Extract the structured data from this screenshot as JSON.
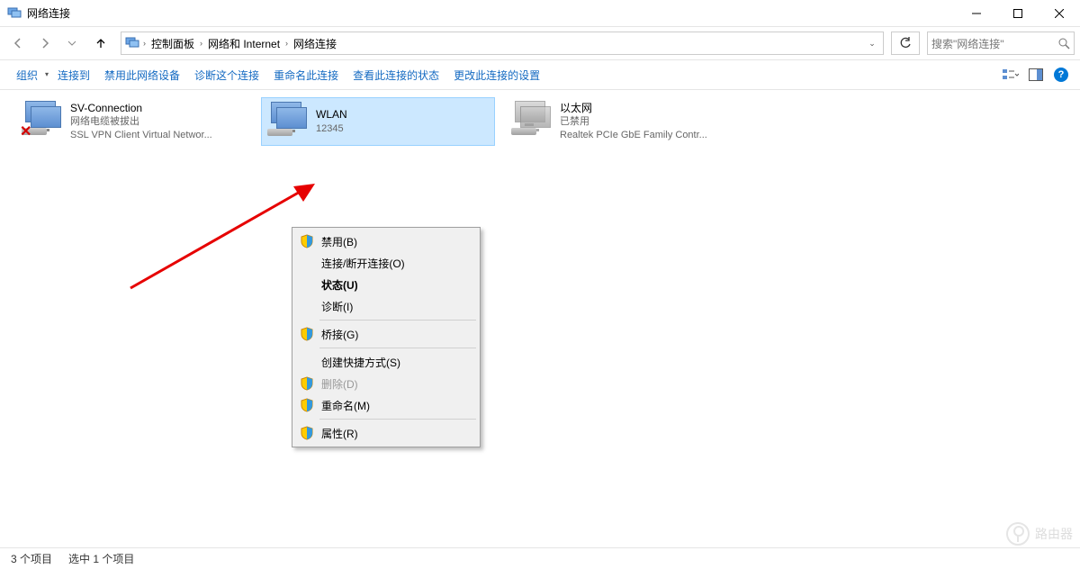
{
  "window": {
    "title": "网络连接"
  },
  "breadcrumb": {
    "items": [
      "控制面板",
      "网络和 Internet",
      "网络连接"
    ]
  },
  "search": {
    "placeholder": "搜索\"网络连接\""
  },
  "commandbar": {
    "organize": "组织",
    "items": [
      "连接到",
      "禁用此网络设备",
      "诊断这个连接",
      "重命名此连接",
      "查看此连接的状态",
      "更改此连接的设置"
    ]
  },
  "connections": [
    {
      "name": "SV-Connection",
      "status": "网络电缆被拔出",
      "device": "SSL VPN Client Virtual Networ...",
      "state": "disconnected"
    },
    {
      "name": "WLAN",
      "status": "12345",
      "device": "",
      "state": "selected"
    },
    {
      "name": "以太网",
      "status": "已禁用",
      "device": "Realtek PCIe GbE Family Contr...",
      "state": "disabled"
    }
  ],
  "context_menu": {
    "items": [
      {
        "label": "禁用(B)",
        "shield": true
      },
      {
        "label": "连接/断开连接(O)"
      },
      {
        "label": "状态(U)",
        "bold": true
      },
      {
        "label": "诊断(I)"
      },
      {
        "sep": true
      },
      {
        "label": "桥接(G)",
        "shield": true
      },
      {
        "sep": true
      },
      {
        "label": "创建快捷方式(S)"
      },
      {
        "label": "删除(D)",
        "shield": true,
        "disabled": true
      },
      {
        "label": "重命名(M)",
        "shield": true
      },
      {
        "sep": true
      },
      {
        "label": "属性(R)",
        "shield": true
      }
    ]
  },
  "statusbar": {
    "count": "3 个项目",
    "selected": "选中 1 个项目"
  },
  "watermark": "路由器"
}
